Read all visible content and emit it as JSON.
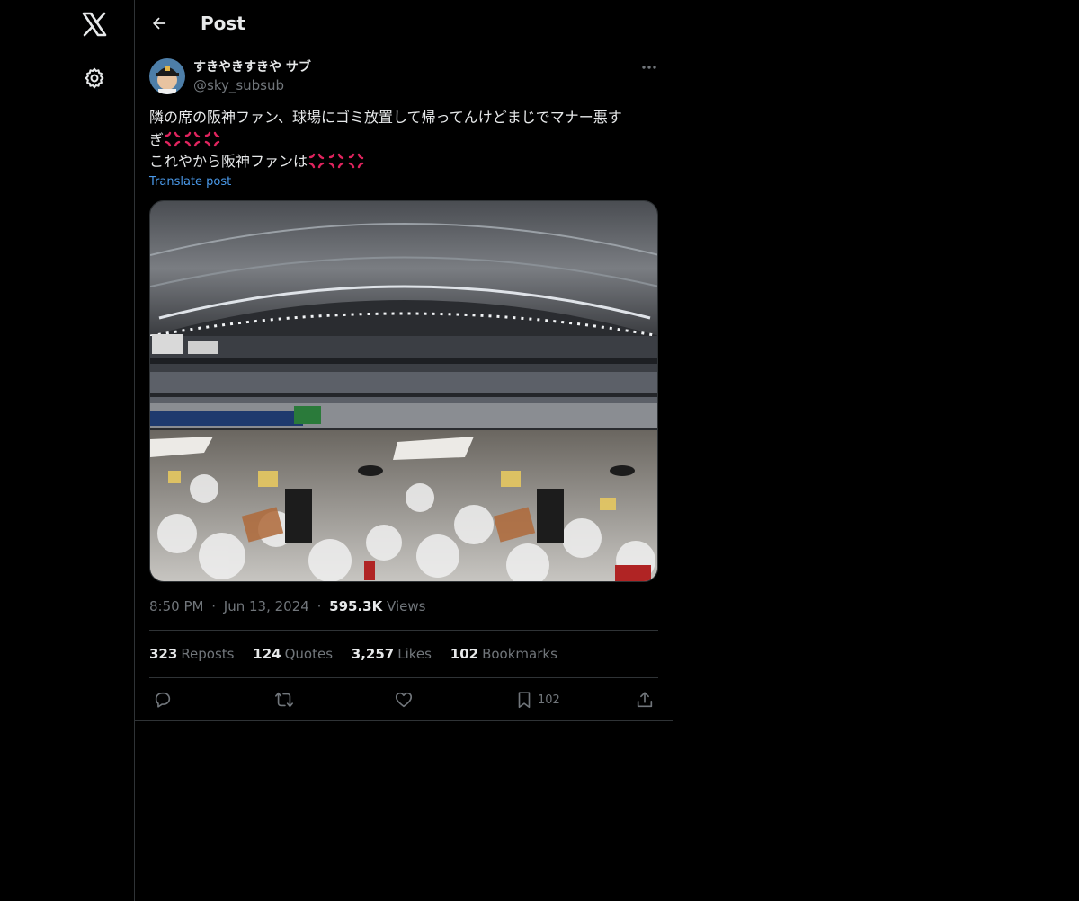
{
  "nav": {
    "logo_icon": "x-logo-icon",
    "settings_icon": "gear-icon"
  },
  "header": {
    "title": "Post"
  },
  "author": {
    "display_name": "すきやきすきや サブ",
    "handle": "@sky_subsub"
  },
  "post": {
    "lines": [
      "隣の席の阪神ファン、球場にゴミ放置して帰ってんけどまじでマナー悪す",
      "ぎ",
      "これやから阪神ファンは"
    ],
    "emoji": "anger-symbol-icon",
    "translate_label": "Translate post"
  },
  "meta": {
    "time": "8:50 PM",
    "date": "Jun 13, 2024",
    "views_count": "595.3K",
    "views_label": "Views",
    "separator": "·"
  },
  "stats": [
    {
      "count": "323",
      "label": "Reposts"
    },
    {
      "count": "124",
      "label": "Quotes"
    },
    {
      "count": "3,257",
      "label": "Likes"
    },
    {
      "count": "102",
      "label": "Bookmarks"
    }
  ],
  "actions": {
    "bookmark_count": "102"
  },
  "colors": {
    "background": "#000000",
    "text": "#e7e9ea",
    "secondary": "#71767b",
    "link": "#4a99e9",
    "border": "#2f3336"
  }
}
